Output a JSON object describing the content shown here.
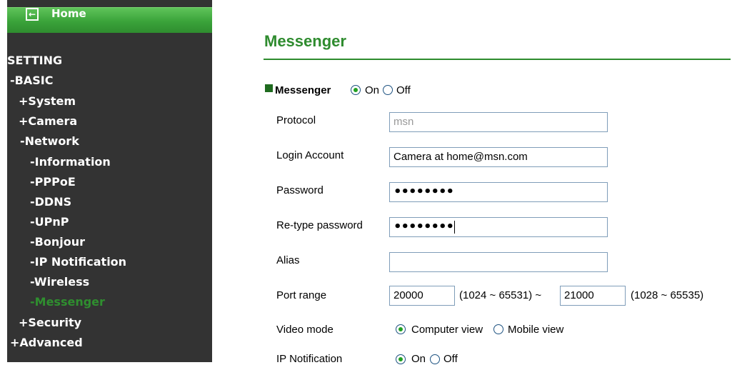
{
  "sidebar": {
    "home_label": "Home",
    "items": [
      {
        "label": "SETTING"
      },
      {
        "label": "-BASIC"
      },
      {
        "label": "+System"
      },
      {
        "label": "+Camera"
      },
      {
        "label": "-Network"
      },
      {
        "label": "-Information"
      },
      {
        "label": "-PPPoE"
      },
      {
        "label": "-DDNS"
      },
      {
        "label": "-UPnP"
      },
      {
        "label": "-Bonjour"
      },
      {
        "label": "-IP Notification"
      },
      {
        "label": "-Wireless"
      },
      {
        "label": "-Messenger"
      },
      {
        "label": "+Security"
      },
      {
        "label": "+Advanced"
      }
    ]
  },
  "main": {
    "title": "Messenger",
    "messenger_label": "Messenger",
    "on_label": "On",
    "off_label": "Off",
    "protocol": {
      "label": "Protocol",
      "value": "msn"
    },
    "login": {
      "label": "Login Account",
      "value": "Camera at home@msn.com"
    },
    "password": {
      "label": "Password",
      "value": "••••••••"
    },
    "retype": {
      "label": "Re-type password",
      "value": "••••••••"
    },
    "alias": {
      "label": "Alias",
      "value": ""
    },
    "port": {
      "label": "Port range",
      "from": "20000",
      "from_range": "(1024 ~ 65531) ~",
      "to": "21000",
      "to_range": "(1028 ~ 65535)"
    },
    "video": {
      "label": "Video mode",
      "opt1": "Computer view",
      "opt2": "Mobile view"
    },
    "ipnotif": {
      "label": "IP Notification",
      "on": "On",
      "off": "Off"
    }
  },
  "colors": {
    "accent": "#2e8b2e",
    "sidebar_bg": "#333333",
    "home_bar": "#3aa33a"
  }
}
